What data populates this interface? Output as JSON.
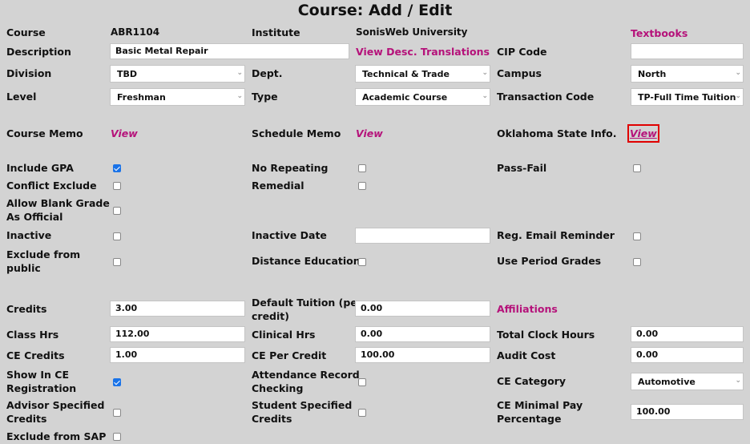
{
  "title": "Course: Add / Edit",
  "labels": {
    "course": "Course",
    "institute": "Institute",
    "textbooks": "Textbooks",
    "description": "Description",
    "view_desc_translations": "View Desc. Translations",
    "cip_code": "CIP Code",
    "division": "Division",
    "dept": "Dept.",
    "campus": "Campus",
    "level": "Level",
    "type": "Type",
    "transaction_code": "Transaction Code",
    "course_memo": "Course Memo",
    "schedule_memo": "Schedule Memo",
    "oklahoma_state_info": "Oklahoma State Info.",
    "view": "View",
    "include_gpa": "Include GPA",
    "no_repeating": "No Repeating",
    "pass_fail": "Pass-Fail",
    "conflict_exclude": "Conflict Exclude",
    "remedial": "Remedial",
    "allow_blank_grade_1": "Allow Blank Grade",
    "allow_blank_grade_2": "As Official",
    "inactive": "Inactive",
    "inactive_date": "Inactive Date",
    "reg_email_reminder": "Reg. Email Reminder",
    "exclude_public_1": "Exclude from",
    "exclude_public_2": "public",
    "distance_education": "Distance Education",
    "use_period_grades": "Use Period Grades",
    "credits": "Credits",
    "default_tuition_1": "Default Tuition (per",
    "default_tuition_2": "credit)",
    "affiliations": "Affiliations",
    "class_hrs": "Class Hrs",
    "clinical_hrs": "Clinical Hrs",
    "total_clock_hours": "Total Clock Hours",
    "ce_credits": "CE Credits",
    "ce_per_credit": "CE Per Credit",
    "audit_cost": "Audit Cost",
    "show_in_ce_1": "Show In CE",
    "show_in_ce_2": "Registration",
    "attendance_1": "Attendance Record",
    "attendance_2": "Checking",
    "ce_category": "CE Category",
    "advisor_1": "Advisor Specified",
    "advisor_2": "Credits",
    "student_1": "Student Specified",
    "student_2": "Credits",
    "ce_min_pay_1": "CE Minimal Pay",
    "ce_min_pay_2": "Percentage",
    "exclude_sap": "Exclude from SAP"
  },
  "values": {
    "course": "ABR1104",
    "institute": "SonisWeb University",
    "description": "Basic Metal Repair",
    "cip_code": "",
    "division": "TBD",
    "dept": "Technical & Trade",
    "campus": "North",
    "level": "Freshman",
    "type": "Academic Course",
    "transaction_code": "TP-Full Time Tuition",
    "inactive_date": "",
    "credits": "3.00",
    "default_tuition": "0.00",
    "class_hrs": "112.00",
    "clinical_hrs": "0.00",
    "total_clock_hours": "0.00",
    "ce_credits": "1.00",
    "ce_per_credit": "100.00",
    "audit_cost": "0.00",
    "ce_category": "Automotive",
    "ce_min_pay": "100.00"
  },
  "checkboxes": {
    "include_gpa": true,
    "no_repeating": false,
    "pass_fail": false,
    "conflict_exclude": false,
    "remedial": false,
    "allow_blank_grade": false,
    "inactive": false,
    "reg_email_reminder": false,
    "exclude_public": false,
    "distance_education": false,
    "use_period_grades": false,
    "show_in_ce": true,
    "attendance_checking": false,
    "advisor_specified": false,
    "student_specified": false,
    "exclude_sap": false
  },
  "icons": {
    "dropdown": "chevron-down-icon",
    "arrow_glyph": "⌄"
  },
  "colors": {
    "link": "#b5127a",
    "highlight": "#e00000",
    "checked": "#1a73e8"
  }
}
